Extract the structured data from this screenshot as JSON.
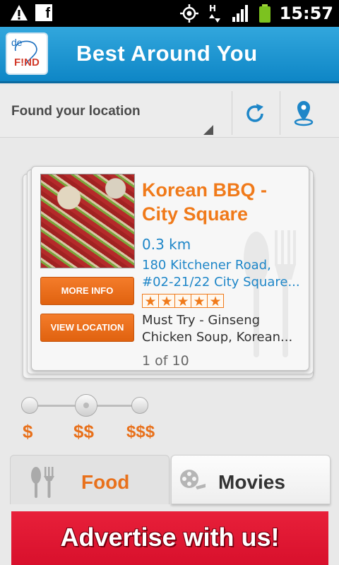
{
  "status_bar": {
    "time": "15:57",
    "icons": [
      "warning-icon",
      "facebook-icon",
      "gps-icon",
      "hsdpa-icon",
      "signal-icon",
      "battery-icon"
    ]
  },
  "header": {
    "logo_top": "de",
    "logo_bottom": "F!ND",
    "title": "Best Around You"
  },
  "location": {
    "status": "Found your location",
    "buttons": [
      "refresh-icon",
      "location-pin-icon"
    ]
  },
  "card": {
    "title": "Korean BBQ - City Square",
    "distance": "0.3 km",
    "address": "180 Kitchener Road, #02-21/22 City Square...",
    "rating_stars": 5,
    "description": "Must Try - Ginseng Chicken Soup, Korean...",
    "counter": "1 of 10",
    "more_info_label": "MORE INFO",
    "view_location_label": "VIEW LOCATION"
  },
  "price_filter": {
    "levels": [
      "$",
      "$$",
      "$$$"
    ],
    "selected": "$$"
  },
  "tabs": {
    "food": "Food",
    "movies": "Movies",
    "active": "Food"
  },
  "ad": {
    "text": "Advertise with us!"
  },
  "colors": {
    "accent_orange": "#f07a1a",
    "link_blue": "#1e86c8",
    "title_bar_blue": "#1a98d6",
    "ad_red": "#e0182f"
  }
}
